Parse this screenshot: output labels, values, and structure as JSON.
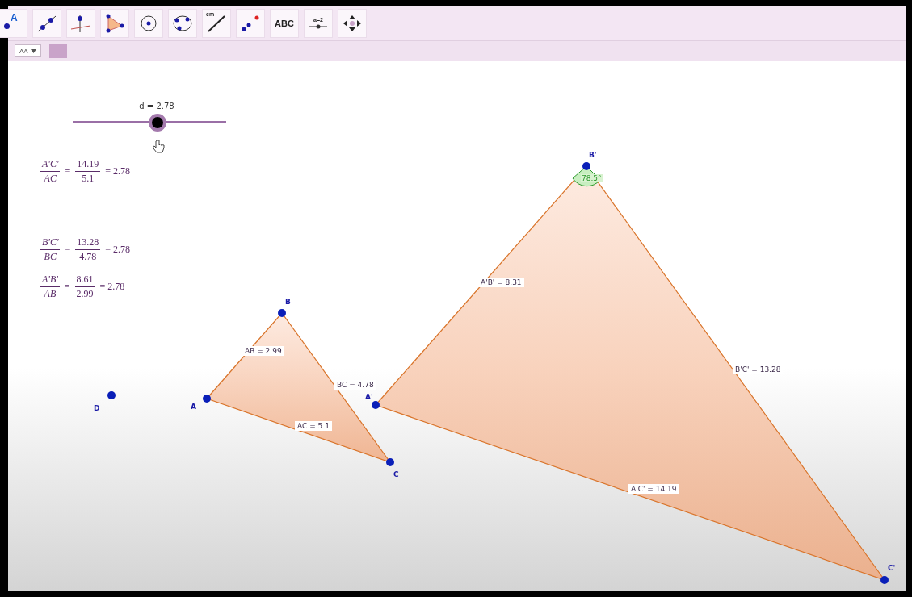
{
  "toolbar": {
    "tools": [
      {
        "kind": "point",
        "label": "A"
      },
      {
        "kind": "line"
      },
      {
        "kind": "perpendicular"
      },
      {
        "kind": "polygon"
      },
      {
        "kind": "circle"
      },
      {
        "kind": "circle3"
      },
      {
        "kind": "distance",
        "label": "cm"
      },
      {
        "kind": "reflect"
      },
      {
        "kind": "text",
        "label": "ABC"
      },
      {
        "kind": "slider",
        "label": "a=2"
      },
      {
        "kind": "move"
      }
    ]
  },
  "style_bar": {
    "font_button": "AA"
  },
  "slider": {
    "label": "d = 2.78",
    "level": 0.55
  },
  "formulas": [
    {
      "parts": [
        {
          "kind": "frac",
          "num": "A'C'",
          "den": "AC",
          "italic": true
        },
        {
          "kind": "op",
          "text": "="
        },
        {
          "kind": "frac",
          "num": "14.19",
          "den": "5.1",
          "italic": false
        },
        {
          "kind": "op",
          "text": "= 2.78"
        }
      ]
    },
    {
      "parts": [
        {
          "kind": "frac",
          "num": "B'C'",
          "den": "BC",
          "italic": true
        },
        {
          "kind": "op",
          "text": "="
        },
        {
          "kind": "frac",
          "num": "13.28",
          "den": "4.78",
          "italic": false
        },
        {
          "kind": "op",
          "text": "= 2.78"
        }
      ]
    },
    {
      "parts": [
        {
          "kind": "frac",
          "num": "A'B'",
          "den": "AB",
          "italic": true
        },
        {
          "kind": "op",
          "text": "="
        },
        {
          "kind": "frac",
          "num": "8.61",
          "den": "2.99",
          "italic": false
        },
        {
          "kind": "op",
          "text": "= 2.78"
        }
      ]
    }
  ],
  "points": [
    {
      "label": "D"
    },
    {
      "label": "A"
    },
    {
      "label": "B"
    },
    {
      "label": "C"
    },
    {
      "label": "A'"
    },
    {
      "label": "B'"
    },
    {
      "label": "C'"
    }
  ],
  "segments": [
    {
      "label": "AB = 2.99"
    },
    {
      "label": "BC = 4.78"
    },
    {
      "label": "AC = 5.1"
    },
    {
      "label": "A'B' = 8.31"
    },
    {
      "label": "B'C' = 13.28"
    },
    {
      "label": "A'C' = 14.19"
    }
  ],
  "angle": {
    "label": "78.5°"
  }
}
